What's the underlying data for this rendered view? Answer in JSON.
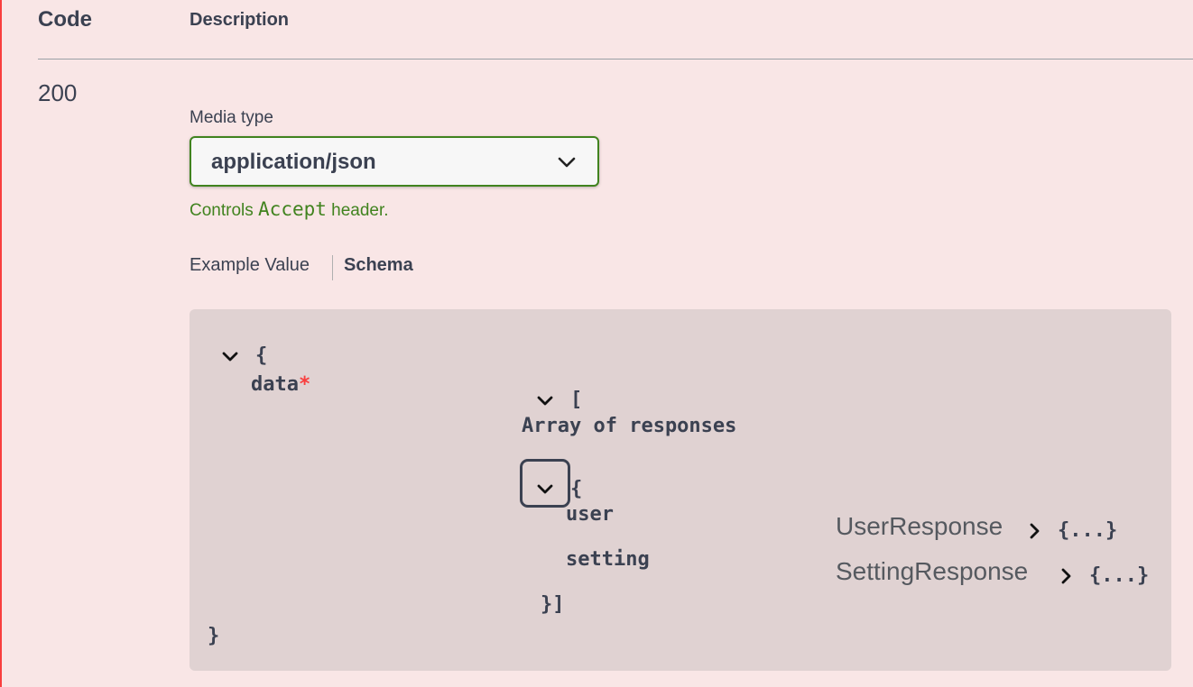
{
  "header": {
    "code_label": "Code",
    "description_label": "Description"
  },
  "response": {
    "code": "200",
    "media_type_label": "Media type",
    "media_type_value": "application/json",
    "controls_prefix": "Controls ",
    "controls_code": "Accept",
    "controls_suffix": " header."
  },
  "tabs": {
    "example_value": "Example Value",
    "schema": "Schema"
  },
  "schema": {
    "open_brace": "{",
    "data_key": "data",
    "required_mark": "*",
    "array_open": "[",
    "array_title": "Array of responses",
    "item_open": "{",
    "user_key": "user",
    "setting_key": "setting",
    "item_array_close": "}]",
    "close_brace": "}",
    "user_model": "UserResponse",
    "user_collapsed": "{...}",
    "setting_model": "SettingResponse",
    "setting_collapsed": "{...}"
  },
  "colors": {
    "background": "#f9e6e6",
    "accent_red": "#f93e3e",
    "select_border_green": "#41831f",
    "schema_box": "#e0d2d2",
    "text": "#3b4151"
  },
  "icons": {
    "dropdown": "chevron-down-icon",
    "expand": "chevron-down-icon",
    "collapsed": "chevron-right-icon"
  }
}
